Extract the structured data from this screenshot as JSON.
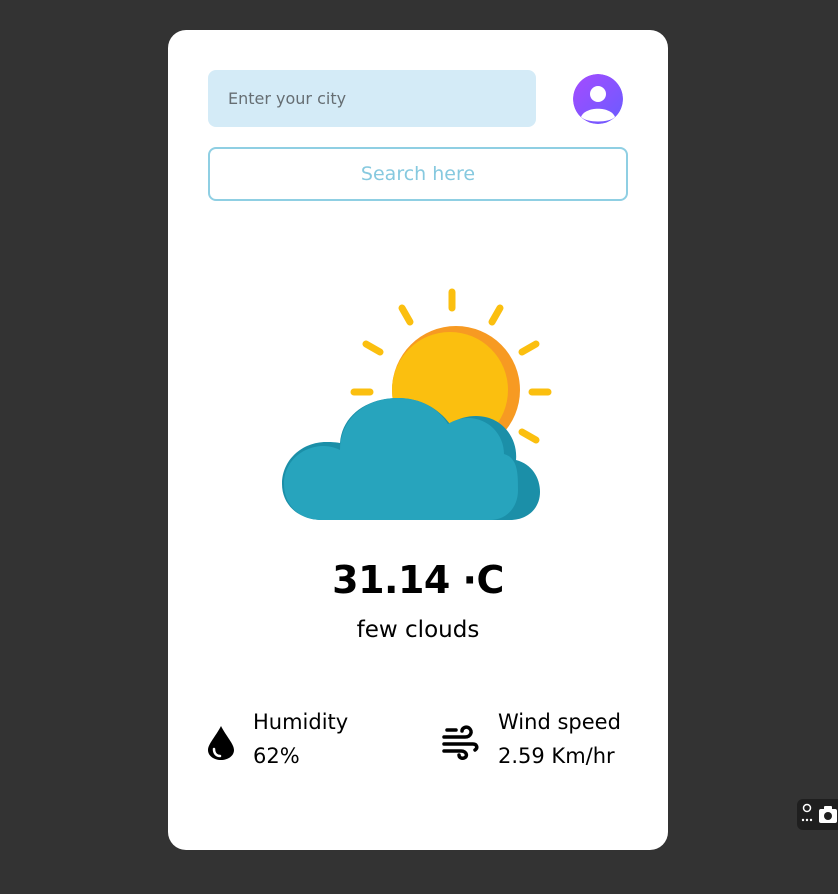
{
  "search": {
    "placeholder": "Enter your city",
    "button_label": "Search here"
  },
  "weather": {
    "temperature": "31.14 ·C",
    "condition": "few clouds",
    "icon": "sun-behind-cloud-icon"
  },
  "stats": {
    "humidity": {
      "label": "Humidity",
      "value": "62%",
      "icon": "water-drop-icon"
    },
    "wind": {
      "label": "Wind speed",
      "value": "2.59 Km/hr",
      "icon": "wind-icon"
    }
  },
  "colors": {
    "page_background": "#333333",
    "card_background": "#ffffff",
    "input_background": "#d4ebf7",
    "search_border": "#8fcfe3",
    "avatar_gradient_start": "#9b4dff",
    "avatar_gradient_end": "#6a5cff",
    "sun": "#fbbf0f",
    "sun_shadow": "#f79a22",
    "cloud": "#27a4bd",
    "cloud_shadow": "#1b8fa8"
  }
}
